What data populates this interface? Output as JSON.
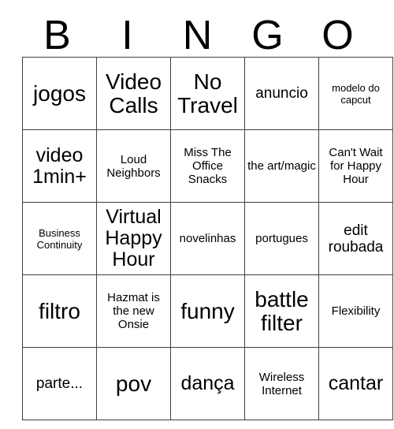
{
  "card": {
    "header": {
      "letters": [
        "B",
        "I",
        "N",
        "G",
        "O"
      ]
    },
    "rows": [
      [
        {
          "text": "jogos",
          "size": "fs-xl"
        },
        {
          "text": "Video Calls",
          "size": "fs-xl"
        },
        {
          "text": "No Travel",
          "size": "fs-xl"
        },
        {
          "text": "anuncio",
          "size": "fs-md"
        },
        {
          "text": "modelo do capcut",
          "size": "fs-xs"
        }
      ],
      [
        {
          "text": "video 1min+",
          "size": "fs-lg"
        },
        {
          "text": "Loud Neighbors",
          "size": "fs-sm"
        },
        {
          "text": "Miss The Office Snacks",
          "size": "fs-sm"
        },
        {
          "text": "the art/magic",
          "size": "fs-sm"
        },
        {
          "text": "Can't Wait for Happy Hour",
          "size": "fs-sm"
        }
      ],
      [
        {
          "text": "Business Continuity",
          "size": "fs-xs"
        },
        {
          "text": "Virtual Happy Hour",
          "size": "fs-lg"
        },
        {
          "text": "novelinhas",
          "size": "fs-sm"
        },
        {
          "text": "portugues",
          "size": "fs-sm"
        },
        {
          "text": "edit roubada",
          "size": "fs-md"
        }
      ],
      [
        {
          "text": "filtro",
          "size": "fs-xl"
        },
        {
          "text": "Hazmat is the new Onsie",
          "size": "fs-sm"
        },
        {
          "text": "funny",
          "size": "fs-xl"
        },
        {
          "text": "battle filter",
          "size": "fs-xl"
        },
        {
          "text": "Flexibility",
          "size": "fs-sm"
        }
      ],
      [
        {
          "text": "parte...",
          "size": "fs-md"
        },
        {
          "text": "pov",
          "size": "fs-xl"
        },
        {
          "text": "dança",
          "size": "fs-lg"
        },
        {
          "text": "Wireless Internet",
          "size": "fs-sm"
        },
        {
          "text": "cantar",
          "size": "fs-lg"
        }
      ]
    ]
  }
}
